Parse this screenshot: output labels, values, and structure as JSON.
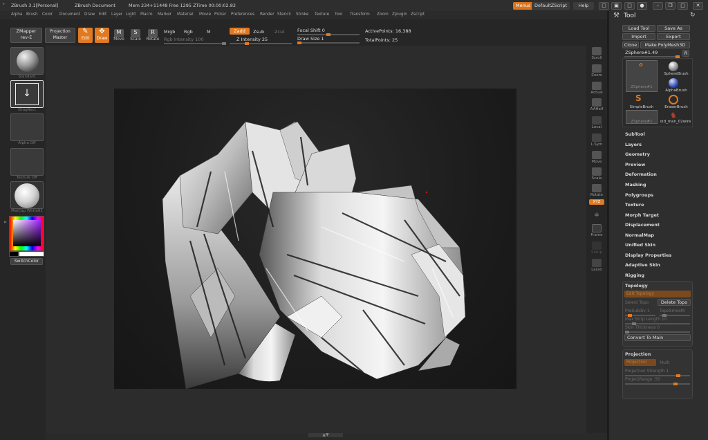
{
  "titlebar": {
    "app": "ZBrush 3.1[Personal]",
    "document": "ZBrush Document",
    "mem": "Mem 234+11448 Free 1295 ZTime 00:00:02.82",
    "menus_btn": "Menus",
    "script_btn": "DefaultZScript",
    "help_btn": "Help"
  },
  "menubar": [
    "Alpha",
    "Brush",
    "Color",
    "Document",
    "Draw",
    "Edit",
    "Layer",
    "Light",
    "Macro",
    "Marker",
    "Material",
    "Movie",
    "Picker",
    "Preferences",
    "Render",
    "Stencil",
    "Stroke",
    "Texture",
    "Tool",
    "Transform",
    "Zoom",
    "Zplugin",
    "Zscript"
  ],
  "shelf": {
    "zmapper": "ZMapper",
    "zmapper_sub": "rev-E",
    "projection": "Projection",
    "projection_sub": "Master",
    "edit": "Edit",
    "draw": "Draw",
    "move": "Move",
    "scale": "Scale",
    "rotate": "Rotate",
    "mrgb": "Mrgb",
    "rgb": "Rgb",
    "m": "M",
    "rgb_intensity": "Rgb Intensity 100",
    "zadd": "Zadd",
    "zsub": "Zsub",
    "zcut": "Zcut",
    "z_intensity": "Z Intensity 25",
    "focal_shift": "Focal Shift 0",
    "draw_size": "Draw Size 1",
    "active_points": "ActivePoints: 16,388",
    "total_points": "TotalPoints: 25"
  },
  "lefttray": {
    "brush": "Standard",
    "stroke": "DragRect",
    "alpha": "Alpha Off",
    "texture": "Texture Off",
    "material": "MatCap White01",
    "switchcolor": "SwitchColor"
  },
  "rightshelf": [
    "Scroll",
    "Zoom",
    "Actual",
    "AAHalf",
    "Local",
    "L.Sym",
    "Move",
    "Scale",
    "Rotate",
    "Frame",
    "Setup",
    "Lasso"
  ],
  "rightshelf_xyz": "XYZ",
  "panel": {
    "title": "Tool",
    "load": "Load Tool",
    "save": "Save As",
    "import": "Import",
    "export": "Export",
    "clone": "Clone",
    "polymesh": "Make PolyMesh3D",
    "current": "ZSphere#1.49",
    "r": "R",
    "thumbs": [
      "ZSphere#1",
      "SphereBrush",
      "AlphaBrush",
      "SimpleBrush",
      "EraserBrush",
      "ZSphere#1",
      "old_man_02wire"
    ],
    "menus": [
      "SubTool",
      "Layers",
      "Geometry",
      "Preview",
      "Deformation",
      "Masking",
      "Polygroups",
      "Texture",
      "Morph Target",
      "Displacement",
      "NormalMap",
      "Unified Skin",
      "Display Properties",
      "Adaptive Skin",
      "Rigging"
    ],
    "topology": {
      "title": "Topology",
      "edit": "Edit Topology",
      "select": "Select Topo",
      "delete": "Delete Topo",
      "presubdiv": "PreSubdiv 1",
      "toposmooth": "TopoSmooth",
      "maxstrip": "Max Strip Length 10",
      "skin": "Skin Thickness 0",
      "convert": "Convert To Main"
    },
    "projection": {
      "title": "Projection",
      "btn": "Projection",
      "multi": "Multi",
      "strength": "Projection Strength 1",
      "range": "ProjectRange .50"
    }
  }
}
